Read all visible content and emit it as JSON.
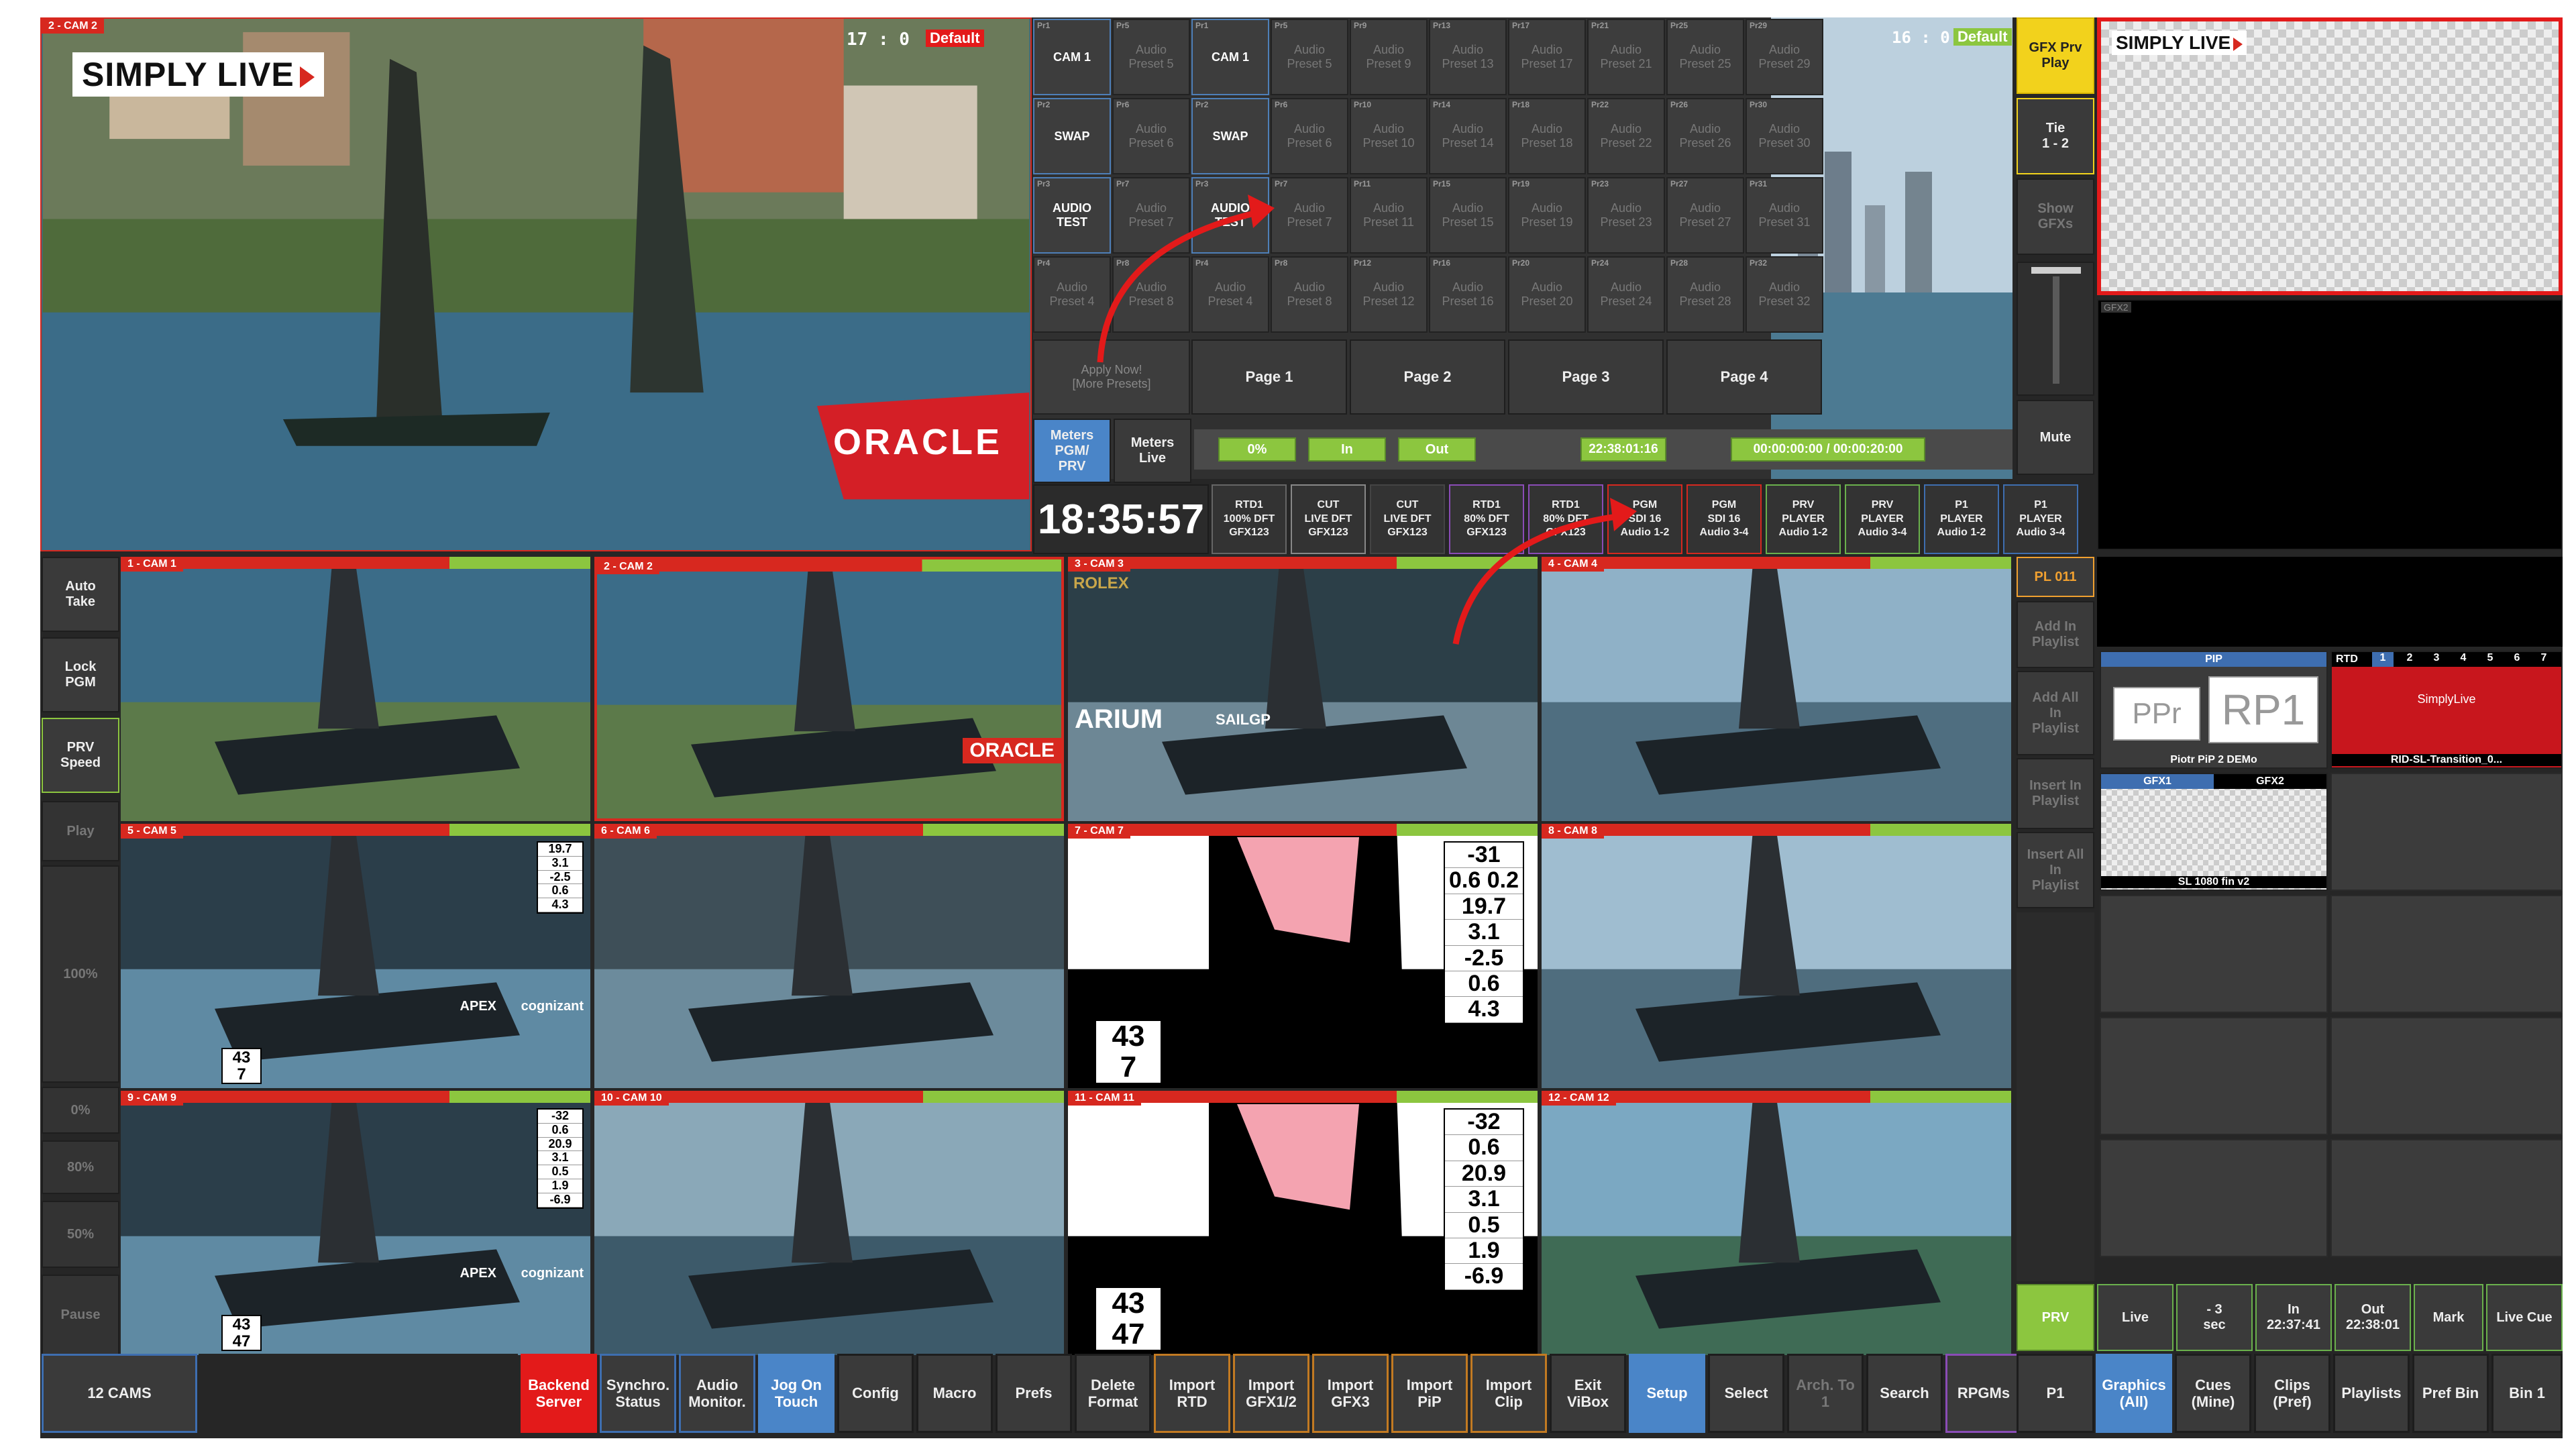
{
  "pgm_monitor": {
    "label": "2 - CAM 2",
    "timecode": "17 : 0",
    "badge": "Default",
    "brand": "SIMPLY LIVE",
    "sponsor": "ORACLE"
  },
  "prv_monitor": {
    "timecode": "16 : 0",
    "badge": "Default"
  },
  "presets_left": [
    {
      "pr": "Pr1",
      "label": "CAM 1",
      "on": true
    },
    {
      "pr": "Pr5",
      "label": "Audio\nPreset 5",
      "on": false
    },
    {
      "pr": "Pr2",
      "label": "SWAP",
      "on": true
    },
    {
      "pr": "Pr6",
      "label": "Audio\nPreset 6",
      "on": false
    },
    {
      "pr": "Pr3",
      "label": "AUDIO\nTEST",
      "on": true
    },
    {
      "pr": "Pr7",
      "label": "Audio\nPreset 7",
      "on": false
    },
    {
      "pr": "Pr4",
      "label": "Audio\nPreset 4",
      "on": false
    },
    {
      "pr": "Pr8",
      "label": "Audio\nPreset 8",
      "on": false
    }
  ],
  "presets_right": [
    {
      "pr": "Pr1",
      "label": "CAM 1",
      "on": true
    },
    {
      "pr": "Pr5",
      "label": "Audio\nPreset 5",
      "on": false
    },
    {
      "pr": "Pr9",
      "label": "Audio\nPreset 9",
      "on": false
    },
    {
      "pr": "Pr13",
      "label": "Audio\nPreset 13",
      "on": false
    },
    {
      "pr": "Pr17",
      "label": "Audio\nPreset 17",
      "on": false
    },
    {
      "pr": "Pr21",
      "label": "Audio\nPreset 21",
      "on": false
    },
    {
      "pr": "Pr25",
      "label": "Audio\nPreset 25",
      "on": false
    },
    {
      "pr": "Pr29",
      "label": "Audio\nPreset 29",
      "on": false
    },
    {
      "pr": "Pr2",
      "label": "SWAP",
      "on": true
    },
    {
      "pr": "Pr6",
      "label": "Audio\nPreset 6",
      "on": false
    },
    {
      "pr": "Pr10",
      "label": "Audio\nPreset 10",
      "on": false
    },
    {
      "pr": "Pr14",
      "label": "Audio\nPreset 14",
      "on": false
    },
    {
      "pr": "Pr18",
      "label": "Audio\nPreset 18",
      "on": false
    },
    {
      "pr": "Pr22",
      "label": "Audio\nPreset 22",
      "on": false
    },
    {
      "pr": "Pr26",
      "label": "Audio\nPreset 26",
      "on": false
    },
    {
      "pr": "Pr30",
      "label": "Audio\nPreset 30",
      "on": false
    },
    {
      "pr": "Pr3",
      "label": "AUDIO\nTEST",
      "on": true
    },
    {
      "pr": "Pr7",
      "label": "Audio\nPreset 7",
      "on": false
    },
    {
      "pr": "Pr11",
      "label": "Audio\nPreset 11",
      "on": false
    },
    {
      "pr": "Pr15",
      "label": "Audio\nPreset 15",
      "on": false
    },
    {
      "pr": "Pr19",
      "label": "Audio\nPreset 19",
      "on": false
    },
    {
      "pr": "Pr23",
      "label": "Audio\nPreset 23",
      "on": false
    },
    {
      "pr": "Pr27",
      "label": "Audio\nPreset 27",
      "on": false
    },
    {
      "pr": "Pr31",
      "label": "Audio\nPreset 31",
      "on": false
    },
    {
      "pr": "Pr4",
      "label": "Audio\nPreset 4",
      "on": false
    },
    {
      "pr": "Pr8",
      "label": "Audio\nPreset 8",
      "on": false
    },
    {
      "pr": "Pr12",
      "label": "Audio\nPreset 12",
      "on": false
    },
    {
      "pr": "Pr16",
      "label": "Audio\nPreset 16",
      "on": false
    },
    {
      "pr": "Pr20",
      "label": "Audio\nPreset 20",
      "on": false
    },
    {
      "pr": "Pr24",
      "label": "Audio\nPreset 24",
      "on": false
    },
    {
      "pr": "Pr28",
      "label": "Audio\nPreset 28",
      "on": false
    },
    {
      "pr": "Pr32",
      "label": "Audio\nPreset 32",
      "on": false
    }
  ],
  "apply_now": "Apply Now!\n[More Presets]",
  "pages": [
    "Page 1",
    "Page 2",
    "Page 3",
    "Page 4"
  ],
  "meters": [
    {
      "label": "Meters\nPGM/\nPRV",
      "active": true
    },
    {
      "label": "Meters\nLive",
      "active": false
    }
  ],
  "clock": "18:35:57",
  "transport": {
    "pct": "0%",
    "in": "In",
    "out": "Out",
    "tc": "22:38:01:16",
    "dur": "00:00:00:00 / 00:00:20:00"
  },
  "routing": [
    {
      "label": "RTD1\n100% DFT\nGFX123",
      "border": "#666666"
    },
    {
      "label": "CUT\nLIVE DFT\nGFX123",
      "border": "#888888"
    },
    {
      "label": "CUT\nLIVE DFT\nGFX123",
      "border": "#444444"
    },
    {
      "label": "RTD1\n80% DFT\nGFX123",
      "border": "#8a4cb6"
    },
    {
      "label": "RTD1\n80% DFT\nGFX123",
      "border": "#8a4cb6"
    },
    {
      "label": "PGM\nSDI 16\nAudio 1-2",
      "border": "#d7281f"
    },
    {
      "label": "PGM\nSDI 16\nAudio 3-4",
      "border": "#d7281f"
    },
    {
      "label": "PRV\nPLAYER\nAudio 1-2",
      "border": "#6ab04c"
    },
    {
      "label": "PRV\nPLAYER\nAudio 3-4",
      "border": "#6ab04c"
    },
    {
      "label": "P1\nPLAYER\nAudio 1-2",
      "border": "#3e6eb0"
    },
    {
      "label": "P1\nPLAYER\nAudio 3-4",
      "border": "#3e6eb0"
    }
  ],
  "gfx_col": {
    "prv_play": "GFX Prv\nPlay",
    "tie": "Tie\n1 - 2",
    "show": "Show\nGFXs",
    "mute": "Mute"
  },
  "gfx_monitor_label": "GFX2",
  "cams": [
    {
      "label": "1 - CAM 1"
    },
    {
      "label": "2 - CAM 2"
    },
    {
      "label": "3 - CAM 3"
    },
    {
      "label": "4 - CAM 4"
    },
    {
      "label": "5 - CAM 5"
    },
    {
      "label": "6 - CAM 6"
    },
    {
      "label": "7 - CAM 7"
    },
    {
      "label": "8 - CAM 8"
    },
    {
      "label": "9 - CAM 9"
    },
    {
      "label": "10 - CAM 10"
    },
    {
      "label": "11 - CAM 11"
    },
    {
      "label": "12 - CAM 12"
    }
  ],
  "overlay_texts": {
    "rolex": "ROLEX",
    "arium": "ARIUM",
    "sailgp": "SAILGP",
    "oracle2": "ORACLE",
    "apex": "APEX",
    "cognizant": "cognizant"
  },
  "telemetry_a": [
    "19.7",
    "3.1",
    "-2.5",
    "0.6",
    "4.3",
    "43",
    "7"
  ],
  "telemetry_b": [
    "-32",
    "0.6",
    "20.9",
    "3.1",
    "0.5",
    "1.9",
    "-6.9",
    "43",
    "47"
  ],
  "telemetry_c": [
    "-31",
    "0.6 0.2",
    "19.7",
    "3.1",
    "-2.5",
    "0.6",
    "4.3",
    "43",
    "7"
  ],
  "telemetry_d": [
    "-32",
    "0.6",
    "20.9",
    "3.1",
    "0.5",
    "1.9",
    "-6.9",
    "43",
    "47"
  ],
  "left_col": [
    "Auto\nTake",
    "Lock\nPGM",
    "PRV\nSpeed",
    "Play",
    "100%",
    "0%",
    "80%",
    "50%",
    "Pause"
  ],
  "playlist": {
    "title": "PL 011",
    "items": [
      "Add In\nPlaylist",
      "Add All\nIn\nPlaylist",
      "Insert In\nPlaylist",
      "Insert All\nIn\nPlaylist"
    ]
  },
  "bins": {
    "pip_tab": "PIP",
    "pip_left": "PPr",
    "pip_right": "RP1",
    "pip_caption": "Piotr PiP 2 DEMo",
    "rtd_tab": "RTD",
    "rtd_nums": [
      "1",
      "2",
      "3",
      "4",
      "5",
      "6",
      "7"
    ],
    "rtd_brand": "SimplyLive",
    "rtd_caption": "RID-SL-Transition_0...",
    "gfx1": "GFX1",
    "gfx2": "GFX2",
    "gfx_caption": "SL 1080 fin v2"
  },
  "player_bar": {
    "prv": "PRV",
    "live": "Live",
    "minus": "- 3\nsec",
    "in": "In\n22:37:41",
    "out": "Out\n22:38:01",
    "mark": "Mark",
    "live_cue": "Live Cue"
  },
  "bottom": [
    {
      "label": "12 CAMS",
      "style": "blu"
    },
    {
      "label": "Backend\nServer",
      "style": "red"
    },
    {
      "label": "Synchro.\nStatus",
      "style": "blu"
    },
    {
      "label": "Audio\nMonitor.",
      "style": "blu"
    },
    {
      "label": "Jog On\nTouch",
      "style": "active"
    },
    {
      "label": "Config",
      "style": ""
    },
    {
      "label": "Macro",
      "style": ""
    },
    {
      "label": "Prefs",
      "style": ""
    },
    {
      "label": "Delete\nFormat",
      "style": ""
    },
    {
      "label": "Import\nRTD",
      "style": "org"
    },
    {
      "label": "Import\nGFX1/2",
      "style": "org"
    },
    {
      "label": "Import\nGFX3",
      "style": "org"
    },
    {
      "label": "Import\nPiP",
      "style": "org"
    },
    {
      "label": "Import\nClip",
      "style": "org"
    },
    {
      "label": "Exit\nViBox",
      "style": ""
    },
    {
      "label": "Setup",
      "style": "active"
    },
    {
      "label": "Select",
      "style": ""
    },
    {
      "label": "Arch. To\n1",
      "style": "dim"
    },
    {
      "label": "Search",
      "style": ""
    },
    {
      "label": "RPGMs",
      "style": "pur"
    },
    {
      "label": "P1",
      "style": ""
    },
    {
      "label": "Graphics\n(All)",
      "style": "active"
    },
    {
      "label": "Cues\n(Mine)",
      "style": ""
    },
    {
      "label": "Clips\n(Pref)",
      "style": ""
    },
    {
      "label": "Playlists",
      "style": ""
    },
    {
      "label": "Pref Bin",
      "style": ""
    },
    {
      "label": "Bin 1",
      "style": ""
    }
  ]
}
